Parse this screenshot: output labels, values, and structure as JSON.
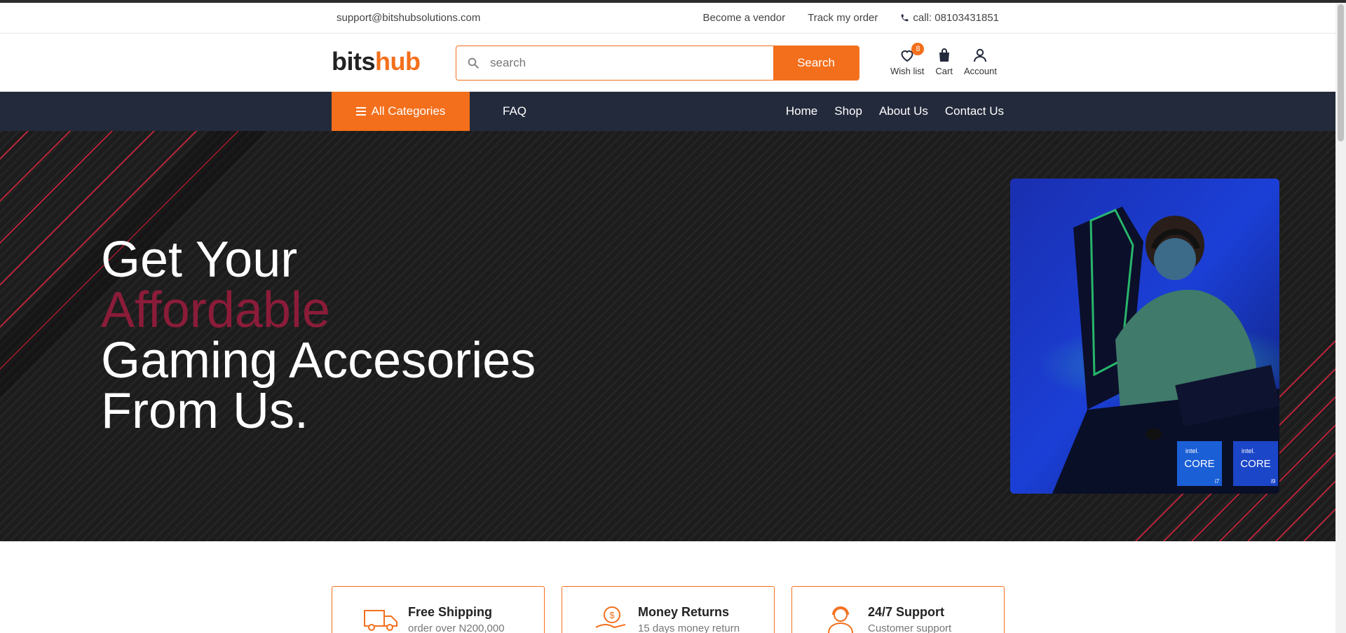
{
  "topbar": {
    "email": "support@bitshubsolutions.com",
    "become_vendor": "Become a vendor",
    "track_order": "Track my order",
    "call": "call: 08103431851"
  },
  "header": {
    "logo_part1": "bits",
    "logo_part2": "hub",
    "search_placeholder": "search",
    "search_button": "Search",
    "wishlist_label": "Wish list",
    "wishlist_count": "8",
    "cart_label": "Cart",
    "account_label": "Account"
  },
  "nav": {
    "all_categories": "All Categories",
    "faq": "FAQ",
    "links": [
      "Home",
      "Shop",
      "About Us",
      "Contact Us"
    ]
  },
  "hero": {
    "line1": "Get Your",
    "line2": "Affordable",
    "line3": "Gaming Accesories",
    "line4": "From Us."
  },
  "features": [
    {
      "title": "Free Shipping",
      "subtitle": "order over N200,000",
      "icon": "truck-icon"
    },
    {
      "title": "Money Returns",
      "subtitle": "15 days money return",
      "icon": "money-return-icon"
    },
    {
      "title": "24/7 Support",
      "subtitle": "Customer support",
      "icon": "support-agent-icon"
    }
  ],
  "colors": {
    "accent": "#f36f1c",
    "nav_bg": "#232a3b",
    "hero_accent": "#8b1c39"
  }
}
